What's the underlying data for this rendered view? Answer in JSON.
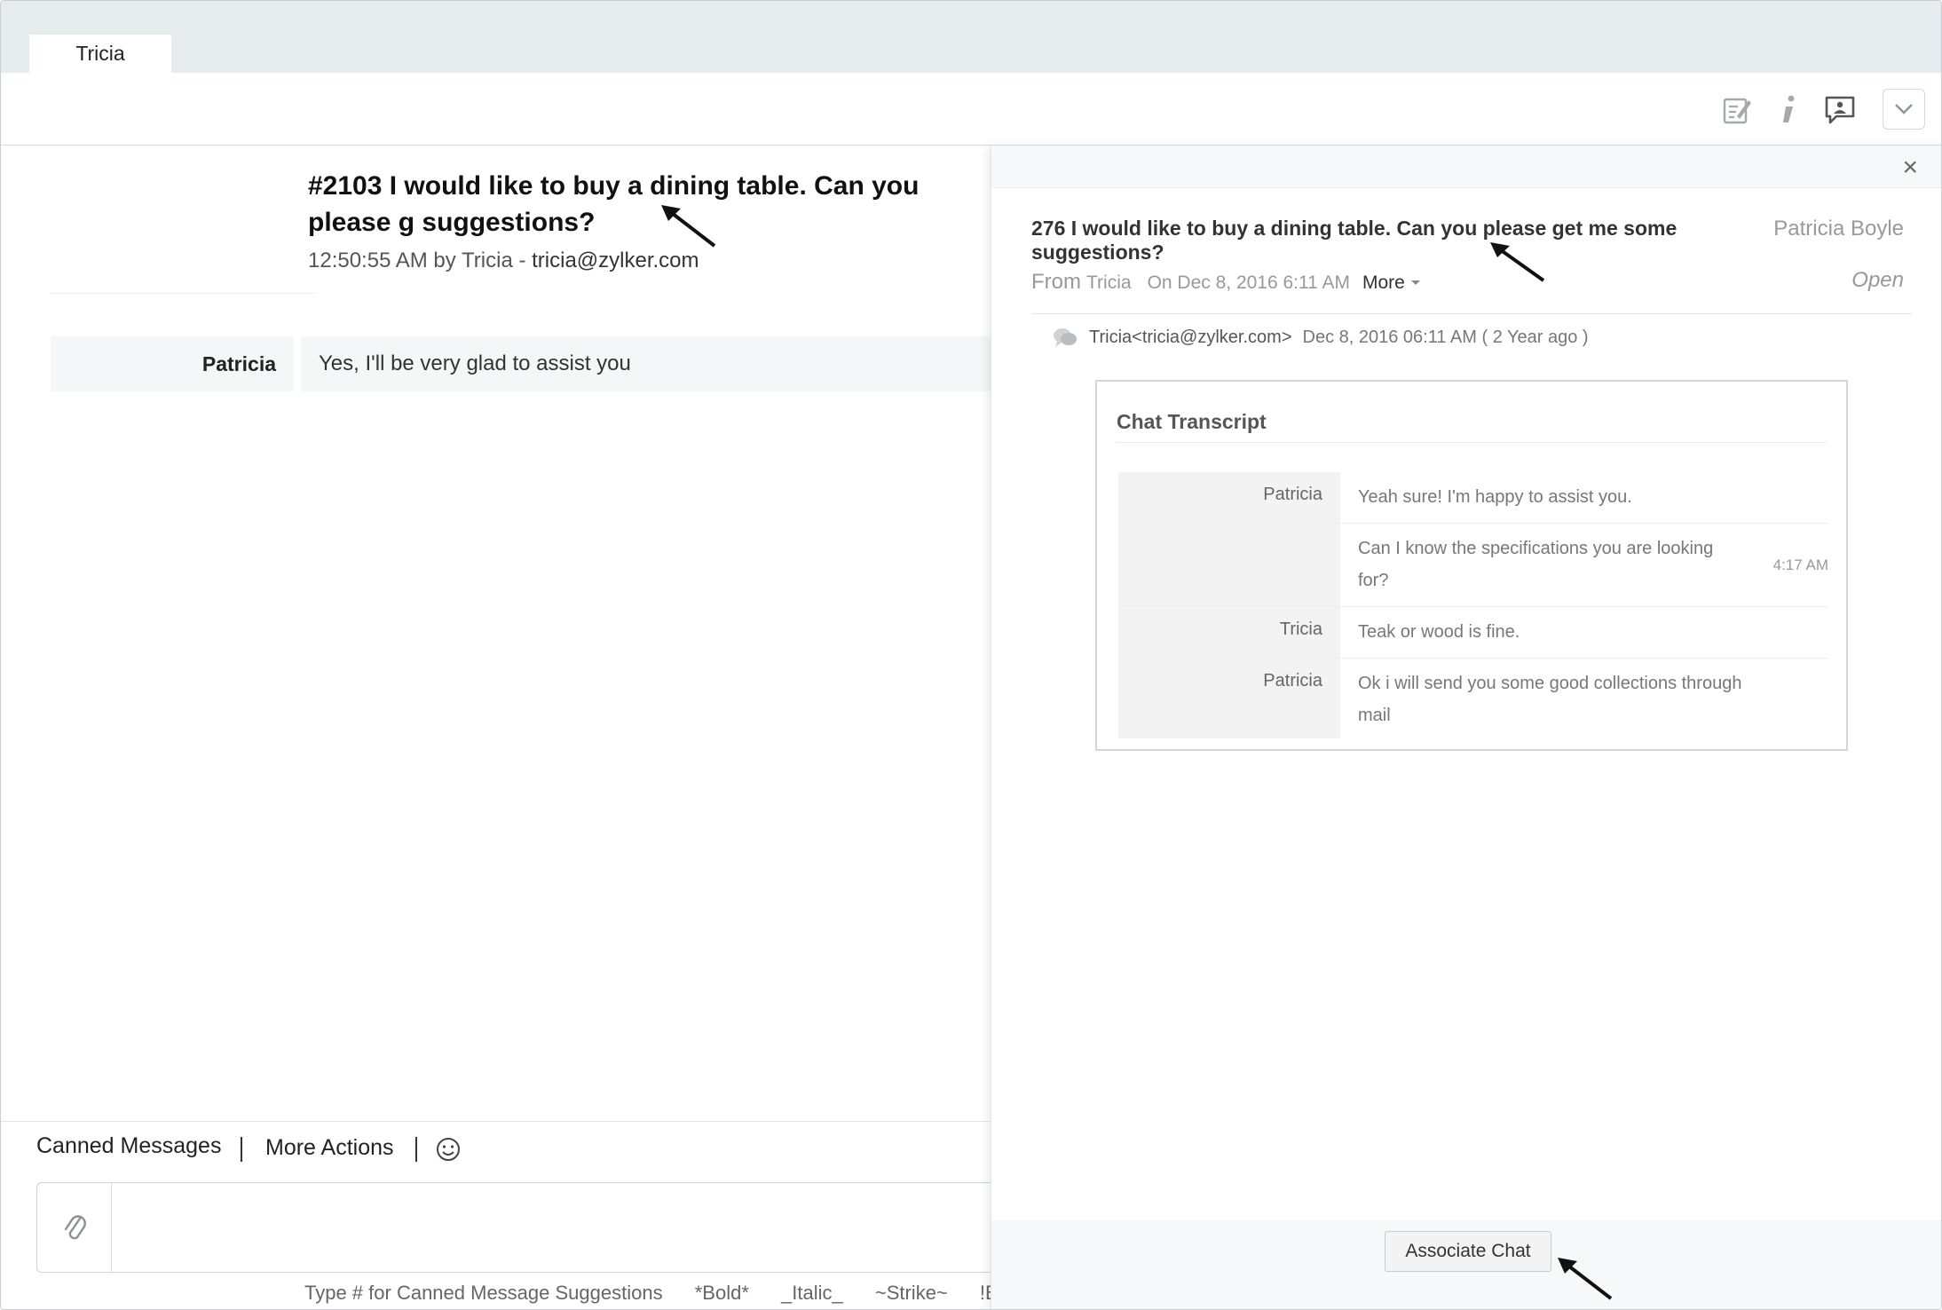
{
  "tab": {
    "label": "Tricia"
  },
  "toolbar": {
    "icons": [
      "edit-icon",
      "info-icon",
      "chat-icon",
      "chevron-down-icon"
    ]
  },
  "conversation": {
    "subject": "#2103  I would like to buy a dining table. Can you please g suggestions?",
    "time_by": "12:50:55 AM by Tricia - ",
    "email": "tricia@zylker.com",
    "message": {
      "name": "Patricia",
      "text": "Yes, I'll be very glad to assist you"
    }
  },
  "composer": {
    "canned_label": "Canned Messages",
    "more_actions_label": "More Actions",
    "hints": [
      "Type # for Canned Message Suggestions",
      "*Bold*",
      "_Italic_",
      "~Strike~",
      "!Blo"
    ]
  },
  "panel": {
    "subject": "276 I would like to buy a dining table. Can you please get me some suggestions?",
    "assignee": "Patricia Boyle",
    "from_label": "From",
    "from_name": "Tricia",
    "from_date": "On Dec 8, 2016 6:11 AM",
    "more_label": "More",
    "status": "Open",
    "sender": "Tricia<tricia@zylker.com>",
    "sender_date": "Dec 8, 2016  06:11 AM ( 2 Year ago )",
    "transcript": {
      "title": "Chat Transcript",
      "rows": [
        {
          "name": "Patricia",
          "text": "Yeah sure! I'm happy to assist you.",
          "time": ""
        },
        {
          "name": "",
          "text": "Can I know the specifications you are looking for?",
          "time": "4:17 AM"
        },
        {
          "name": "Tricia",
          "text": "Teak or wood is fine.",
          "time": ""
        },
        {
          "name": "Patricia",
          "text": "Ok i will send you some good collections through mail",
          "time": ""
        }
      ]
    },
    "associate_label": "Associate Chat"
  },
  "colors": {
    "accent_bg": "#e6ebee",
    "row_bg": "#f4f6f8"
  }
}
